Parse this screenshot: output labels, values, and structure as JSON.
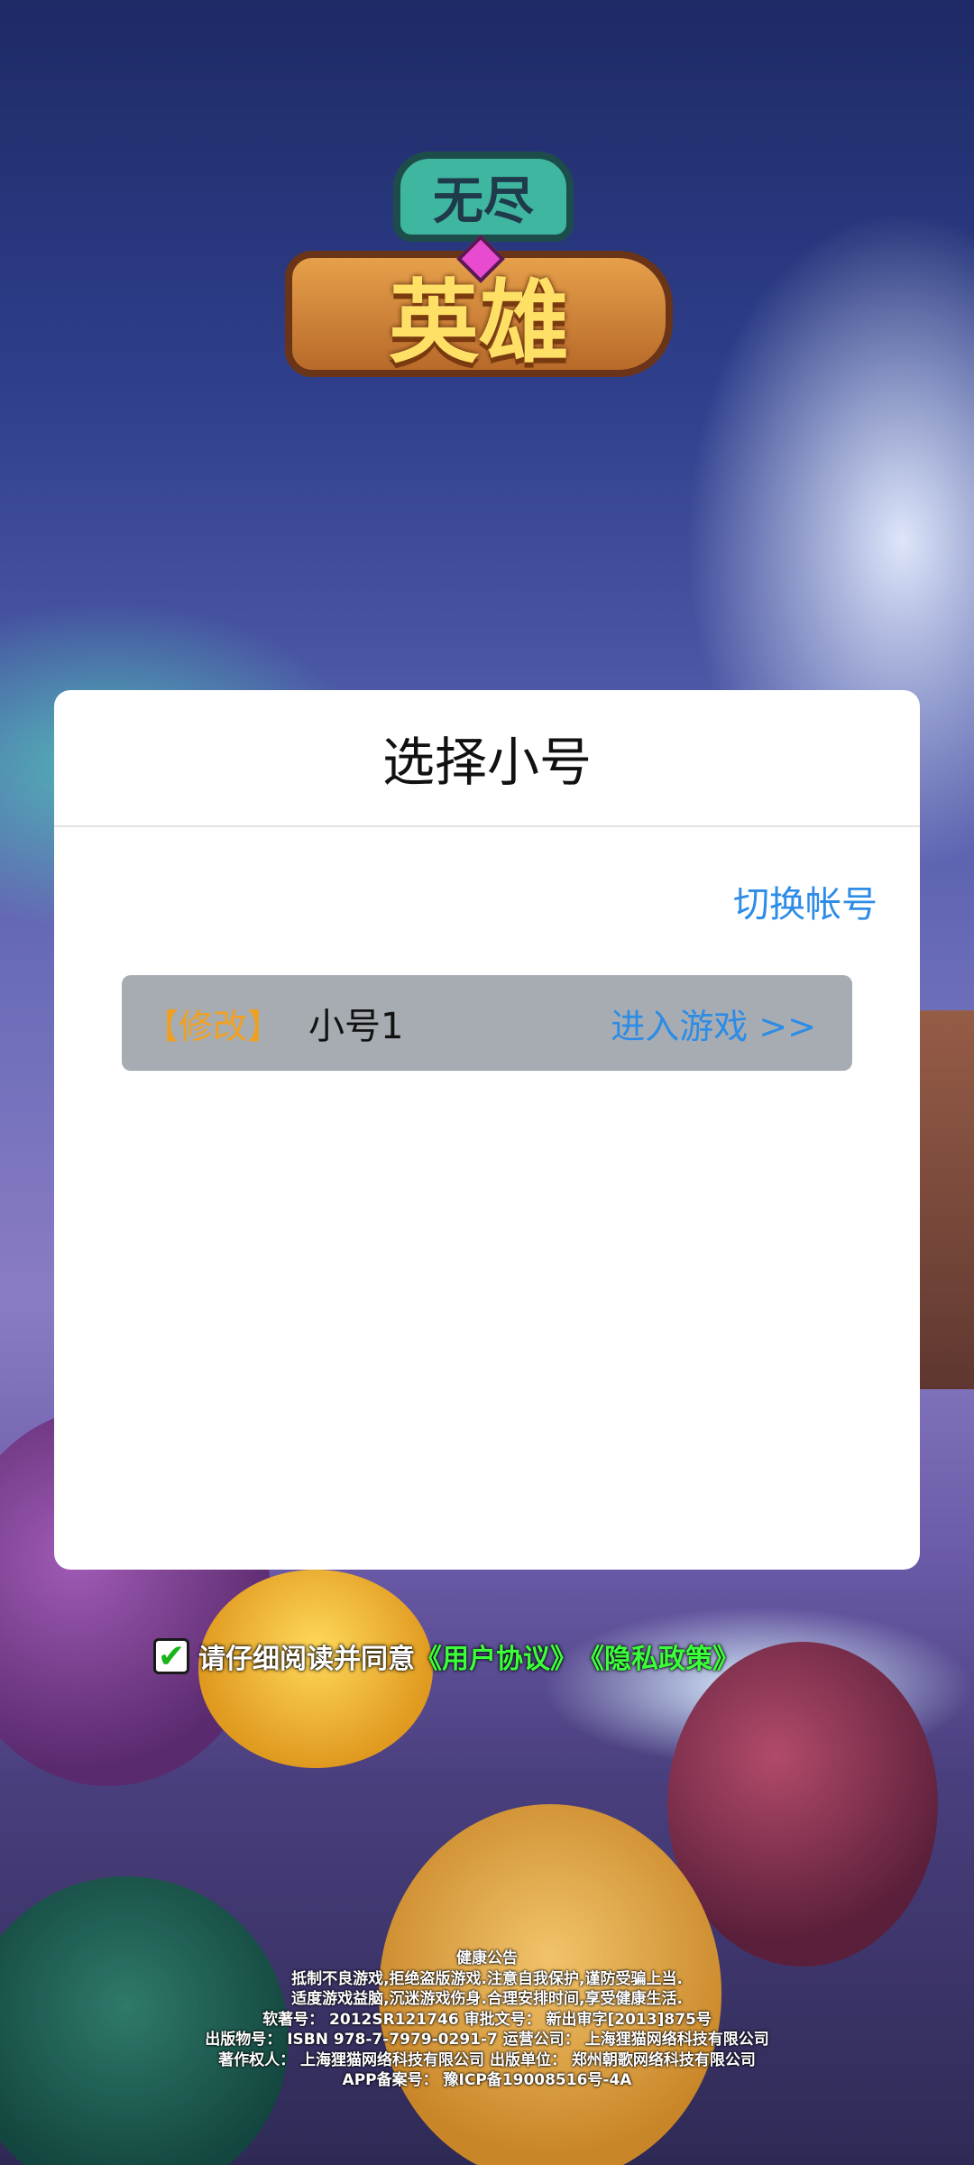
{
  "logo": {
    "top_text": "无尽",
    "main_text": "英雄"
  },
  "dialog": {
    "title": "选择小号",
    "switch_account": "切换帐号",
    "accounts": [
      {
        "edit_label": "【修改】",
        "name": "小号1",
        "enter_label": "进入游戏 >>"
      }
    ]
  },
  "agreement": {
    "checked_icon": "✔",
    "text": "请仔细阅读并同意",
    "user_agreement": "《用户协议》",
    "privacy_policy": "《隐私政策》"
  },
  "notice": {
    "title": "健康公告",
    "line1": "抵制不良游戏,拒绝盗版游戏.注意自我保护,谨防受骗上当.",
    "line2": "适度游戏益脑,沉迷游戏伤身.合理安排时间,享受健康生活.",
    "line3": "软著号：  2012SR121746  审批文号：  新出审字[2013]875号",
    "line4": "出版物号：  ISBN  978-7-7979-0291-7    运营公司：  上海狸猫网络科技有限公司",
    "line5": "著作权人：  上海狸猫网络科技有限公司    出版单位：  郑州朝歌网络科技有限公司",
    "line6": "APP备案号：  豫ICP备19008516号-4A"
  },
  "colors": {
    "link_blue": "#2d8ce6",
    "edit_orange": "#f0a020",
    "agree_green": "#3cff3c"
  }
}
